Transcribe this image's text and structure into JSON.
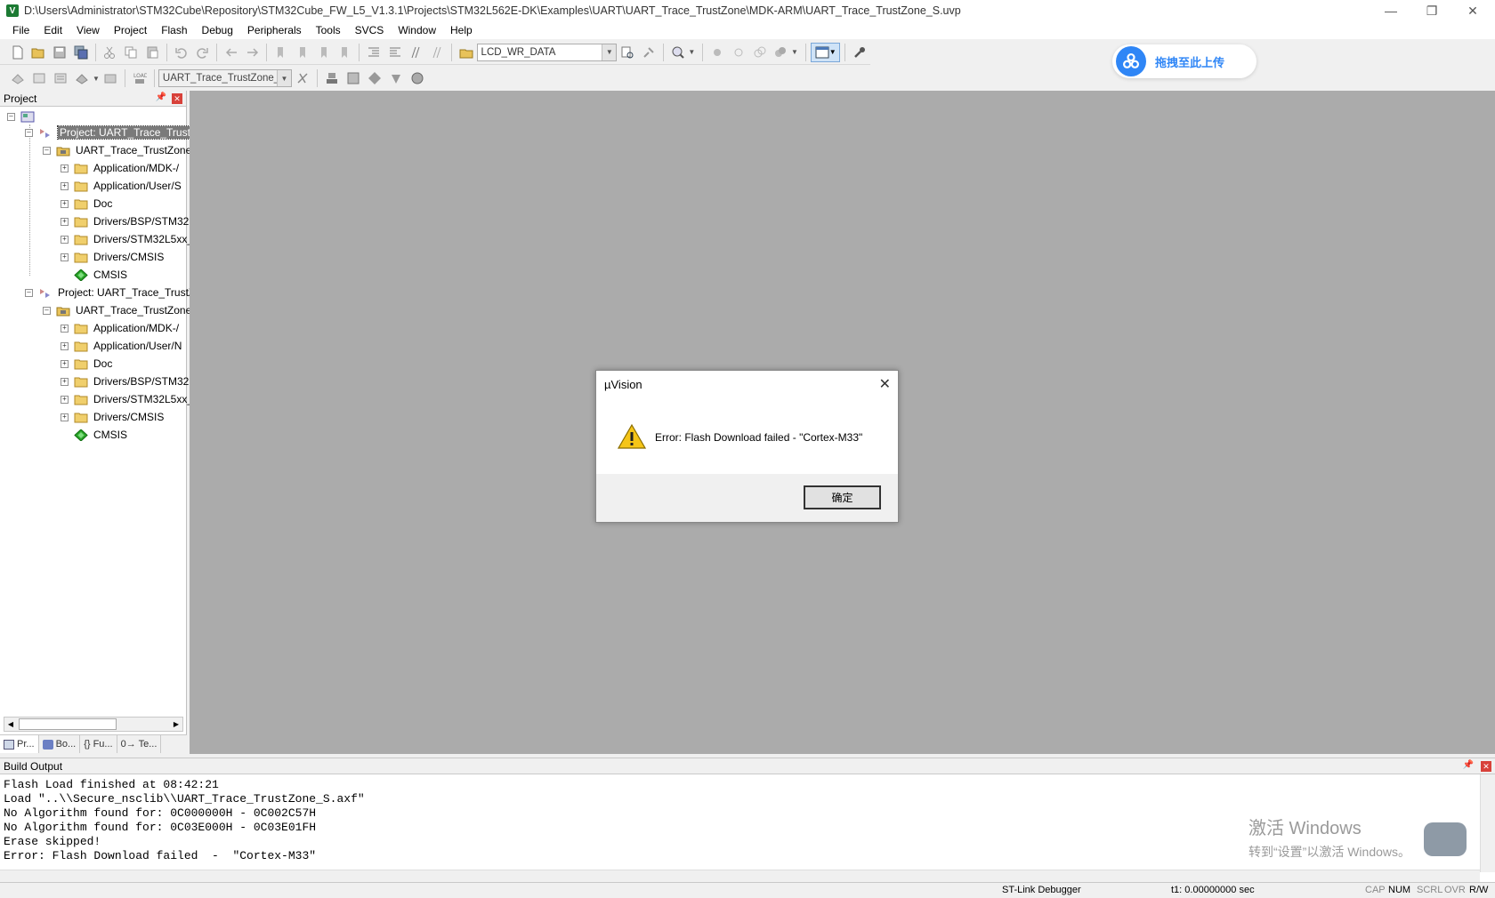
{
  "window": {
    "title": "D:\\Users\\Administrator\\STM32Cube\\Repository\\STM32Cube_FW_L5_V1.3.1\\Projects\\STM32L562E-DK\\Examples\\UART\\UART_Trace_TrustZone\\MDK-ARM\\UART_Trace_TrustZone_S.uvp",
    "app_icon": "V"
  },
  "menu": [
    "File",
    "Edit",
    "View",
    "Project",
    "Flash",
    "Debug",
    "Peripherals",
    "Tools",
    "SVCS",
    "Window",
    "Help"
  ],
  "toolbar": {
    "find_combo": "LCD_WR_DATA",
    "target_combo": "UART_Trace_TrustZone_S"
  },
  "cloud_upload": {
    "label": "拖拽至此上传",
    "color": "#2f86f6"
  },
  "project_panel": {
    "title": "Project",
    "tree": [
      {
        "label": "Project: UART_Trace_TrustZ",
        "level": 1,
        "icon": "project-icon",
        "selected": true
      },
      {
        "label": "UART_Trace_TrustZone_",
        "level": 2,
        "icon": "target-folder-icon"
      },
      {
        "label": "Application/MDK-/",
        "level": 3,
        "icon": "folder-icon"
      },
      {
        "label": "Application/User/S",
        "level": 3,
        "icon": "folder-icon"
      },
      {
        "label": "Doc",
        "level": 3,
        "icon": "folder-icon"
      },
      {
        "label": "Drivers/BSP/STM32",
        "level": 3,
        "icon": "folder-icon"
      },
      {
        "label": "Drivers/STM32L5xx_",
        "level": 3,
        "icon": "folder-icon"
      },
      {
        "label": "Drivers/CMSIS",
        "level": 3,
        "icon": "folder-icon"
      },
      {
        "label": "CMSIS",
        "level": 3,
        "icon": "cmsis-diamond-icon"
      },
      {
        "label": "Project: UART_Trace_TrustZ",
        "level": 1,
        "icon": "project-icon"
      },
      {
        "label": "UART_Trace_TrustZone_",
        "level": 2,
        "icon": "target-folder-icon"
      },
      {
        "label": "Application/MDK-/",
        "level": 3,
        "icon": "folder-icon"
      },
      {
        "label": "Application/User/N",
        "level": 3,
        "icon": "folder-icon"
      },
      {
        "label": "Doc",
        "level": 3,
        "icon": "folder-icon"
      },
      {
        "label": "Drivers/BSP/STM32",
        "level": 3,
        "icon": "folder-icon"
      },
      {
        "label": "Drivers/STM32L5xx_",
        "level": 3,
        "icon": "folder-icon"
      },
      {
        "label": "Drivers/CMSIS",
        "level": 3,
        "icon": "folder-icon"
      },
      {
        "label": "CMSIS",
        "level": 3,
        "icon": "cmsis-diamond-icon"
      }
    ],
    "tabs": [
      "Pr...",
      "Bo...",
      "{} Fu...",
      "0→ Te..."
    ]
  },
  "dialog": {
    "title": "µVision",
    "message": "Error: Flash Download failed  -  \"Cortex-M33\"",
    "ok_label": "确定"
  },
  "build_output": {
    "title": "Build Output",
    "lines": [
      "Flash Load finished at 08:42:21",
      "Load \"..\\\\Secure_nsclib\\\\UART_Trace_TrustZone_S.axf\"",
      "No Algorithm found for: 0C000000H - 0C002C57H",
      "No Algorithm found for: 0C03E000H - 0C03E01FH",
      "Erase skipped!",
      "Error: Flash Download failed  -  \"Cortex-M33\""
    ],
    "watermark_line1": "激活 Windows",
    "watermark_line2": "转到“设置”以激活 Windows。"
  },
  "status": {
    "debugger": "ST-Link Debugger",
    "time": "t1: 0.00000000 sec",
    "cap": "CAP",
    "num": "NUM",
    "scrl": "SCRL",
    "ovr": "OVR",
    "rw": "R/W"
  }
}
